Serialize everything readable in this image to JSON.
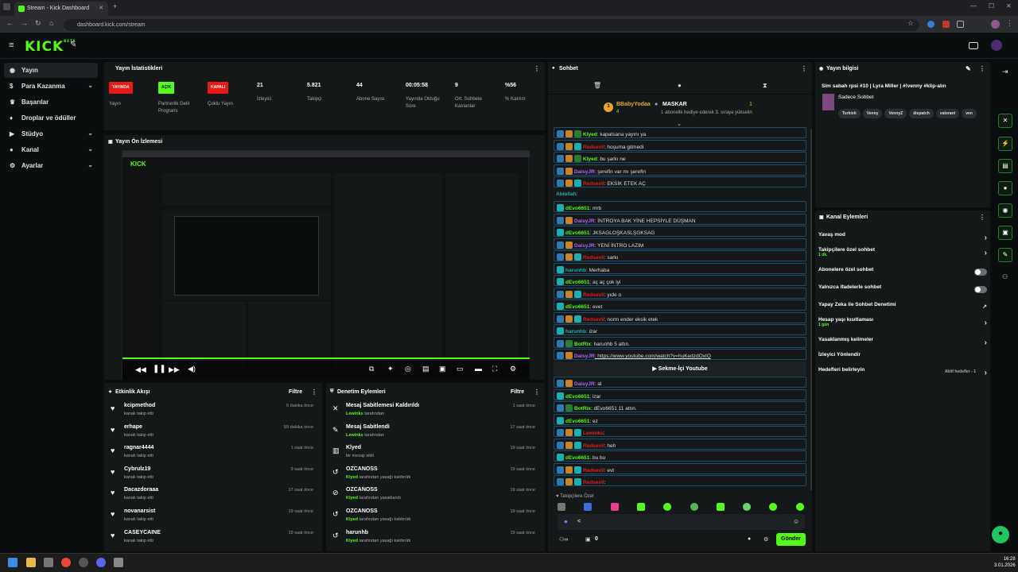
{
  "browser": {
    "tab_title": "Stream - Kick Dashboard",
    "url": "dashboard.kick.com/stream"
  },
  "sidebar": {
    "items": [
      {
        "label": "Yayın",
        "icon": "broadcast-icon"
      },
      {
        "label": "Para Kazanma",
        "icon": "money-icon"
      },
      {
        "label": "Başarılar",
        "icon": "trophy-icon"
      },
      {
        "label": "Droplar ve ödüller",
        "icon": "gift-icon"
      },
      {
        "label": "Stüdyo",
        "icon": "studio-icon"
      },
      {
        "label": "Kanal",
        "icon": "person-icon"
      },
      {
        "label": "Ayarlar",
        "icon": "gear-icon"
      }
    ]
  },
  "stats": {
    "title": "Yayın İstatistikleri",
    "items": [
      {
        "value": "YAYINDA",
        "label": "Yayın",
        "badge_color": "#e91916"
      },
      {
        "value": "AÇIK",
        "label": "Partnerlik Gelir Programı",
        "badge_color": "#53fc18"
      },
      {
        "value": "KAPALI",
        "label": "Çoklu Yayın",
        "badge_color": "#e91916"
      },
      {
        "value": "21",
        "label": "İzleyici"
      },
      {
        "value": "5.821",
        "label": "Takipçi"
      },
      {
        "value": "44",
        "label": "Abone Sayısı"
      },
      {
        "value": "00:05:58",
        "label": "Yayında Olduğu Süre"
      },
      {
        "value": "9",
        "label": "Ort. Sohbete Katılanlar"
      },
      {
        "value": "%56",
        "label": "% Katılım"
      }
    ]
  },
  "preview": {
    "title": "Yayın Ön İzlemesi"
  },
  "activity": {
    "title": "Etkinlik Akışı",
    "filter": "Filtre",
    "items": [
      {
        "name": "kcipmethod",
        "action": "kanalı takip etti",
        "time": "6 dakika önce"
      },
      {
        "name": "erhape",
        "action": "kanalı takip etti",
        "time": "59 dakika önce"
      },
      {
        "name": "ragnar4444",
        "action": "kanalı takip etti",
        "time": "1 saat önce"
      },
      {
        "name": "Cybrulz19",
        "action": "kanalı takip etti",
        "time": "9 saat önce"
      },
      {
        "name": "Dacazdoraaa",
        "action": "kanalı takip etti",
        "time": "17 saat önce"
      },
      {
        "name": "novanarsist",
        "action": "kanalı takip etti",
        "time": "19 saat önce"
      },
      {
        "name": "CASEYCAINE",
        "action": "kanalı takip etti",
        "time": "19 saat önce"
      }
    ]
  },
  "moderation": {
    "title": "Denetim Eylemleri",
    "filter": "Filtre",
    "items": [
      {
        "title": "Mesaj Sabitlemesi Kaldırıldı",
        "actor": "Lewinks",
        "rest": "tarafından",
        "time": "1 saat önce",
        "icon": "unpin-icon"
      },
      {
        "title": "Mesaj Sabitlendi",
        "actor": "Lewinks",
        "rest": "tarafından",
        "time": "17 saat önce",
        "icon": "pin-icon"
      },
      {
        "title": "Klyed",
        "actor": "",
        "rest": "bir mesajı sildi",
        "time": "19 saat önce",
        "icon": "trash-icon"
      },
      {
        "title": "OZCANOSS",
        "actor": "Klyed",
        "rest": "tarafından yasağı kaldırıldı",
        "time": "19 saat önce",
        "icon": "undo-icon"
      },
      {
        "title": "OZCANOSS",
        "actor": "Klyed",
        "rest": "tarafından yasaklandı",
        "time": "19 saat önce",
        "icon": "ban-icon"
      },
      {
        "title": "OZCANOSS",
        "actor": "Klyed",
        "rest": "tarafından yasağı kaldırıldı",
        "time": "19 saat önce",
        "icon": "undo-icon"
      },
      {
        "title": "harunhb",
        "actor": "Klyed",
        "rest": "tarafından yasağı kaldırıldı",
        "time": "19 saat önce",
        "icon": "undo-icon"
      }
    ]
  },
  "chat": {
    "title": "Sohbet",
    "top_user": "BBabyYodaa",
    "top_count": "4",
    "top_rank": "1",
    "leader": "MASKAR",
    "leader_count": "1",
    "leader_note": "1 abonelik hediye ederek 3. sıraya yükselin",
    "messages": [
      {
        "user": "Klyed",
        "text": ": kapatsana yayını ya",
        "color": "#53fc18",
        "icons": [
          "sq-blue",
          "sq-or",
          "sq-grn"
        ]
      },
      {
        "user": "Redsevil",
        "text": ": hoşuma gitmedi",
        "color": "#e91916",
        "icons": [
          "sq-blue",
          "sq-or",
          "sq-cy"
        ]
      },
      {
        "user": "Klyed",
        "text": ": bu şarkı ne",
        "color": "#53fc18",
        "icons": [
          "sq-blue",
          "sq-or",
          "sq-grn"
        ]
      },
      {
        "user": "DaisyJR",
        "text": ": şerefin var mı şerefin",
        "color": "#b066ff",
        "icons": [
          "sq-blue",
          "sq-or"
        ]
      },
      {
        "user": "Redsevil",
        "text": ": EKSİK ETEK AÇ",
        "color": "#e91916",
        "icons": [
          "sq-blue",
          "sq-or",
          "sq-cy"
        ]
      },
      {
        "user": "Abiullah",
        "text": ":",
        "color": "#1ab0b0",
        "icons": []
      },
      {
        "user": "dEvo6651",
        "text": ": mrb",
        "color": "#53fc18",
        "icons": [
          "sq-cy"
        ]
      },
      {
        "user": "DaisyJR",
        "text": ": İNTROYA BAK YİNE HEPSİYLE DÜŞMAN",
        "color": "#b066ff",
        "icons": [
          "sq-blue",
          "sq-or"
        ]
      },
      {
        "user": "dEvo6651",
        "text": ": JKSAGLOŞKASLŞGKSAG",
        "color": "#53fc18",
        "icons": [
          "sq-cy"
        ]
      },
      {
        "user": "DaisyJR",
        "text": ": YENİ İNTRO LAZIM",
        "color": "#b066ff",
        "icons": [
          "sq-blue",
          "sq-or"
        ]
      },
      {
        "user": "Redsevil",
        "text": ": sarkı",
        "color": "#e91916",
        "icons": [
          "sq-blue",
          "sq-or",
          "sq-cy"
        ]
      },
      {
        "user": "harunhb",
        "text": ": Merhaba",
        "color": "#1ab0b0",
        "icons": [
          "sq-cy"
        ]
      },
      {
        "user": "dEvo6651",
        "text": ": aç aç çok iyi",
        "color": "#53fc18",
        "icons": [
          "sq-cy"
        ]
      },
      {
        "user": "Redsevil",
        "text": ": yıde o",
        "color": "#e91916",
        "icons": [
          "sq-blue",
          "sq-or",
          "sq-cy"
        ]
      },
      {
        "user": "dEvo6651",
        "text": ": evet",
        "color": "#53fc18",
        "icons": [
          "sq-cy"
        ]
      },
      {
        "user": "Redsevil",
        "text": ": norm ender eksik etek",
        "color": "#e91916",
        "icons": [
          "sq-blue",
          "sq-or",
          "sq-cy"
        ]
      },
      {
        "user": "harunhb",
        "text": ": izar",
        "color": "#1ab0b0",
        "icons": [
          "sq-cy"
        ]
      },
      {
        "user": "BotRix",
        "text": ": harunhb 5 attın.",
        "color": "#53fc18",
        "icons": [
          "sq-blue",
          "sq-grn"
        ]
      },
      {
        "user": "DaisyJR",
        "text": ": https://www.youtube.com/watch?v=huKedzdOxIQ",
        "color": "#b066ff",
        "icons": [
          "sq-blue",
          "sq-or"
        ]
      }
    ],
    "youtube_label": "Sekme-İçi Youtube",
    "messages2": [
      {
        "user": "DaisyJR",
        "text": ": al",
        "color": "#b066ff",
        "icons": [
          "sq-blue",
          "sq-or"
        ]
      },
      {
        "user": "dEvo6651",
        "text": ": izar",
        "color": "#53fc18",
        "icons": [
          "sq-cy"
        ]
      },
      {
        "user": "BotRix",
        "text": ": dEvo6651 11 attın.",
        "color": "#53fc18",
        "icons": [
          "sq-blue",
          "sq-grn"
        ]
      },
      {
        "user": "dEvo6651",
        "text": ": ez",
        "color": "#53fc18",
        "icons": [
          "sq-cy"
        ]
      },
      {
        "user": "Lewinks",
        "text": ":",
        "color": "#e91916",
        "icons": [
          "sq-blue",
          "sq-or",
          "sq-cy"
        ]
      },
      {
        "user": "Redsevil",
        "text": ": heh",
        "color": "#e91916",
        "icons": [
          "sq-blue",
          "sq-or",
          "sq-cy"
        ]
      },
      {
        "user": "dEvo6651",
        "text": ": bu bu",
        "color": "#53fc18",
        "icons": [
          "sq-cy"
        ]
      },
      {
        "user": "Redsevil",
        "text": ": evt",
        "color": "#e91916",
        "icons": [
          "sq-blue",
          "sq-or",
          "sq-cy"
        ]
      },
      {
        "user": "Redsevil",
        "text": ":",
        "color": "#e91916",
        "icons": [
          "sq-blue",
          "sq-or",
          "sq-cy"
        ]
      }
    ],
    "followers_label": "Takipçilere Özel",
    "input_value": "<",
    "send_label": "Gönder",
    "viewers_count": "0"
  },
  "stream_info": {
    "title": "Yayın bilgisi",
    "stream_title": "Sim sabah rpsi #10 | Lyra Miller | #!venny #klip-alın",
    "category": "Sadece Sohbet",
    "tags": [
      "Turkish",
      "Venny",
      "VennyZ",
      "dispatch",
      "valorant",
      "ven"
    ]
  },
  "channel_actions": {
    "title": "Kanal Eylemleri",
    "items": [
      {
        "label": "Yavaş mod",
        "sub": "",
        "kind": "arrow"
      },
      {
        "label": "Takipçilere özel sohbet",
        "sub": "1 dk.",
        "kind": "arrow"
      },
      {
        "label": "Abonelere özel sohbet",
        "sub": "",
        "kind": "toggle"
      },
      {
        "label": "Yalnızca ifadelerle sohbet",
        "sub": "",
        "kind": "toggle"
      },
      {
        "label": "Yapay Zeka ile Sohbet Denetimi",
        "sub": "",
        "kind": "ext"
      },
      {
        "label": "Hesap yaşı kısıtlaması",
        "sub": "1 gün",
        "kind": "arrow"
      },
      {
        "label": "Yasaklanmış kelimeler",
        "sub": "",
        "kind": "arrow"
      },
      {
        "label": "İzleyici Yönlendir",
        "sub": "",
        "kind": "none"
      },
      {
        "label": "Hedefleri belirleyin",
        "sub": "",
        "kind": "arrow",
        "extra": "Aktif hedefler - 1"
      }
    ]
  },
  "taskbar": {
    "time": "16:28",
    "date": "3.01.2026"
  },
  "colors": {
    "accent": "#53fc18",
    "danger": "#e91916",
    "panel": "#151819",
    "bg": "#0b0e0f"
  }
}
